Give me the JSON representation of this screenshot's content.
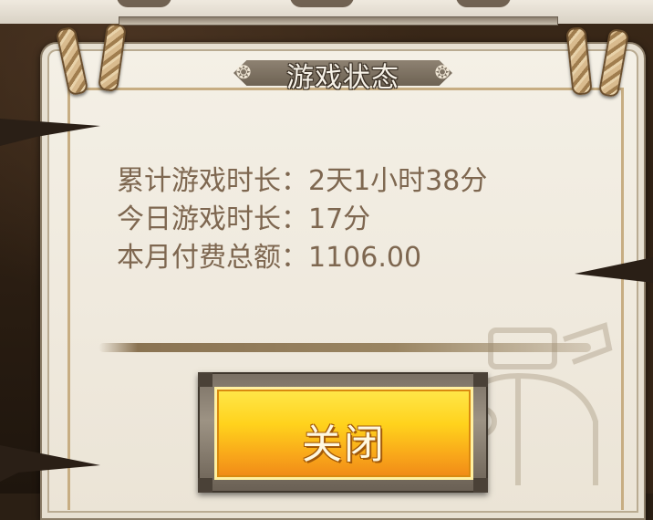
{
  "dialog": {
    "title": "游戏状态",
    "title_ornament_left": "❂",
    "title_ornament_right": "❂",
    "stats": [
      {
        "label": "累计游戏时长：",
        "value": "2天1小时38分"
      },
      {
        "label": "今日游戏时长：",
        "value": "17分"
      },
      {
        "label": "本月付费总额：",
        "value": "1106.00"
      }
    ],
    "close_label": "关闭"
  },
  "colors": {
    "parchment": "#f4f0e6",
    "stat_text": "#7e6750",
    "button_gold": "#ffd21c",
    "button_orange": "#f08a17"
  },
  "icons": [
    "rope-loop-icon",
    "title-ornament-icon",
    "elephant-watermark-icon"
  ]
}
